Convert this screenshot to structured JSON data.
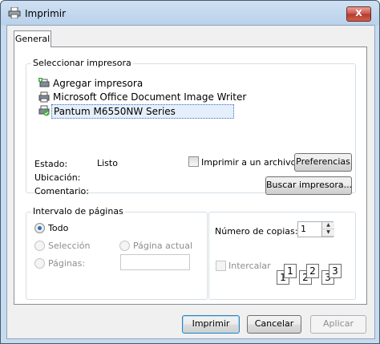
{
  "window": {
    "title": "Imprimir",
    "close_glyph": "X"
  },
  "tabs": [
    {
      "label": "General"
    }
  ],
  "printer_group": {
    "label": "Seleccionar impresora",
    "printers": [
      {
        "label": "Agregar impresora",
        "icon": "add-printer-icon"
      },
      {
        "label": "Microsoft Office Document Image Writer",
        "icon": "printer-icon"
      },
      {
        "label": "Pantum M6550NW Series",
        "icon": "default-printer-icon",
        "selected": true
      }
    ],
    "status_label": "Estado:",
    "status_value": "Listo",
    "location_label": "Ubicación:",
    "comment_label": "Comentario:",
    "print_to_file_label": "Imprimir a un archivo",
    "preferences_button": "Preferencias",
    "find_printer_button": "Buscar impresora..."
  },
  "page_range": {
    "label": "Intervalo de páginas",
    "options": [
      {
        "label": "Todo",
        "checked": true,
        "disabled": false
      },
      {
        "label": "Selección",
        "checked": false,
        "disabled": true
      },
      {
        "label": "Página actual",
        "checked": false,
        "disabled": true
      },
      {
        "label": "Páginas:",
        "checked": false,
        "disabled": true
      }
    ],
    "pages_input": ""
  },
  "copies": {
    "label": "Número de copias:",
    "value": "1",
    "collate_label": "Intercalar",
    "collate_checked": false,
    "collate_pages": [
      "1",
      "1",
      "2",
      "2",
      "3",
      "3"
    ]
  },
  "buttons": {
    "print": "Imprimir",
    "cancel": "Cancelar",
    "apply": "Aplicar"
  },
  "colors": {
    "accent": "#2a6fb4",
    "titlebar": "#c6dbef",
    "close": "#c75050"
  }
}
